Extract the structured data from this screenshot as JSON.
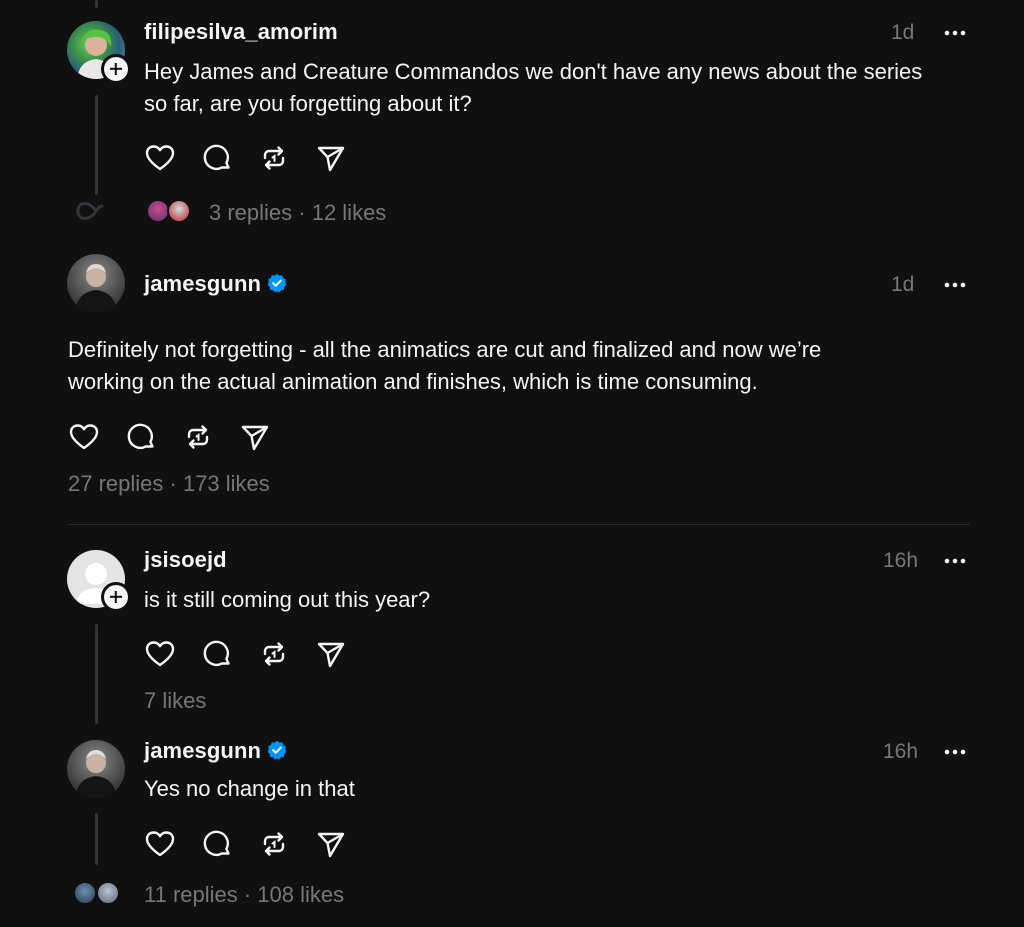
{
  "posts": [
    {
      "username": "filipesilva_amorim",
      "time": "1d",
      "text": "Hey James and Creature Commandos we don't have any news about the series so far, are you forgetting about it?",
      "stats": "3 replies · 12 likes"
    },
    {
      "username": "jamesgunn",
      "time": "1d",
      "text_line1": "Definitely not forgetting - all the animatics are cut and finalized and now we’re",
      "text_line2": "working on the actual animation and finishes, which is time consuming.",
      "stats": "27 replies · 173 likes"
    },
    {
      "username": "jsisoejd",
      "time": "16h",
      "text": "is it still coming out this year?",
      "stats": "7 likes"
    },
    {
      "username": "jamesgunn",
      "time": "16h",
      "text": "Yes no change in that",
      "stats": "11 replies · 108 likes"
    }
  ],
  "icons": {
    "like": "heart-icon",
    "reply": "comment-icon",
    "repost": "repost-icon",
    "share": "send-icon",
    "more": "more-icon",
    "verified": "verified-badge-icon",
    "follow": "plus-icon"
  },
  "colors": {
    "background": "#101010",
    "text": "#f3f5f7",
    "muted": "#777777",
    "verified": "#0095f6"
  }
}
